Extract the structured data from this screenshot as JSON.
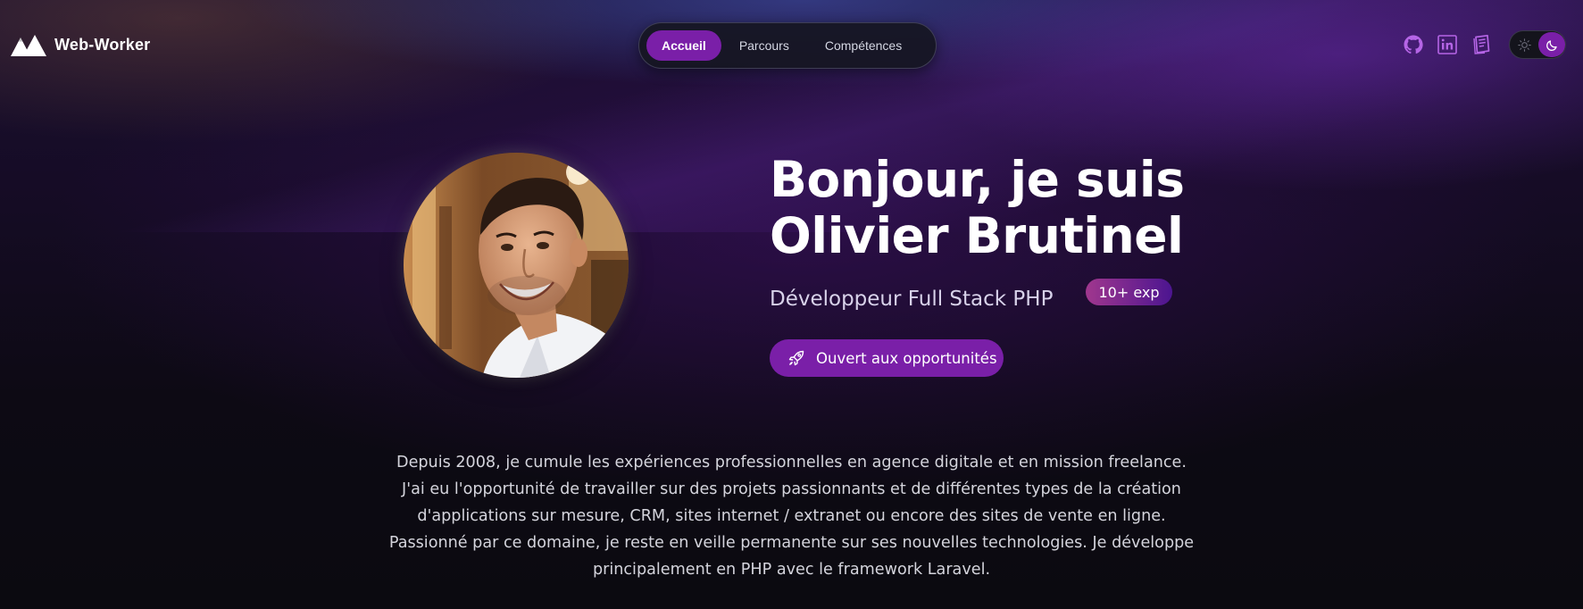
{
  "brand": {
    "name": "Web-Worker",
    "logo_icon": "mountain-logo"
  },
  "nav": {
    "items": [
      {
        "label": "Accueil",
        "active": true
      },
      {
        "label": "Parcours",
        "active": false
      },
      {
        "label": "Compétences",
        "active": false
      }
    ]
  },
  "social": [
    {
      "icon": "github-icon"
    },
    {
      "icon": "linkedin-icon"
    },
    {
      "icon": "notebook-icon"
    }
  ],
  "theme_toggle": {
    "mode": "dark",
    "icons": [
      "sun-icon",
      "moon-icon"
    ]
  },
  "hero": {
    "title_line1": "Bonjour, je suis",
    "title_line2": "Olivier Brutinel",
    "subtitle": "Développeur Full Stack PHP",
    "badge": "10+ exp",
    "cta_label": "Ouvert aux opportunités",
    "cta_icon": "rocket-icon"
  },
  "about": {
    "lines": [
      "Depuis 2008, je cumule les expériences professionnelles en agence digitale et en mission freelance.",
      "J'ai eu l'opportunité de travailler sur des projets passionnants et de différentes types de la création",
      "d'applications sur mesure, CRM, sites internet / extranet ou encore des sites de vente en ligne.",
      "Passionné par ce domaine, je reste en veille permanente sur ses nouvelles technologies. Je développe",
      "principalement en PHP avec le framework Laravel."
    ]
  },
  "colors": {
    "accent": "#7a1fa8",
    "background": "#0c0a12",
    "text": "#ffffff",
    "muted_text": "#d4d4dc"
  }
}
